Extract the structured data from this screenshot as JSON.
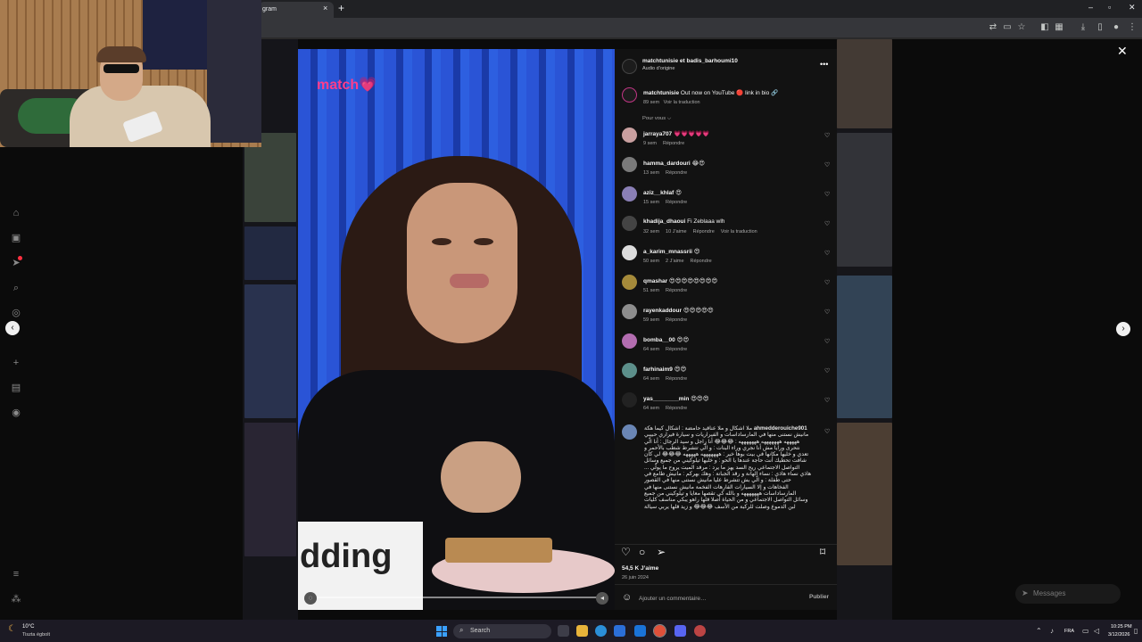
{
  "browser": {
    "tab_title": "gram",
    "new_tab_icon": "+",
    "close_tab_icon": "×"
  },
  "post": {
    "author": "matchtunisie et badis_barhoumi10",
    "audio": "Audio d’origine",
    "caption_user": "matchtunisie",
    "caption_text": "Out now on YouTube 🔴 link in bio 🔗",
    "caption_age": "89 sem",
    "caption_translate": "Voir la traduction",
    "sort_label": "Pour vous ⌵",
    "video_brand": "match💗",
    "card_text": "dding",
    "likes": "54,5 K J’aime",
    "date": "26 juin 2024",
    "comment_placeholder": "Ajouter un commentaire…",
    "post_button": "Publier"
  },
  "comments": [
    {
      "user": "jarraya707",
      "text": "💗💗💗💗💗",
      "age": "9 sem",
      "likes": "",
      "reply": "Répondre",
      "translate": "",
      "avatar": "#c9a0a0"
    },
    {
      "user": "hamma_dardouri",
      "text": "😂😍",
      "age": "13 sem",
      "likes": "",
      "reply": "Répondre",
      "translate": "",
      "avatar": "#7a7a7a"
    },
    {
      "user": "aziz__khlaf",
      "text": "😍",
      "age": "15 sem",
      "likes": "",
      "reply": "Répondre",
      "translate": "",
      "avatar": "#8a7fb5"
    },
    {
      "user": "khadija_dhaoui",
      "text": "Fi Zeblaaa wlh",
      "age": "32 sem",
      "likes": "10 J’aime",
      "reply": "Répondre",
      "translate": "Voir la traduction",
      "avatar": "#444"
    },
    {
      "user": "a_karim_mnassrii",
      "text": "😍",
      "age": "50 sem",
      "likes": "2 J’aime",
      "reply": "Répondre",
      "translate": "",
      "avatar": "#dcdcdc"
    },
    {
      "user": "qmashar",
      "text": "😍😍😍😍😍😍😍😍",
      "age": "51 sem",
      "likes": "",
      "reply": "Répondre",
      "translate": "",
      "avatar": "#a58a3a"
    },
    {
      "user": "rayenkaddour",
      "text": "😍😍😍😍😍",
      "age": "59 sem",
      "likes": "",
      "reply": "Répondre",
      "translate": "",
      "avatar": "#8d8d8d"
    },
    {
      "user": "bomba__00",
      "text": "😍😍",
      "age": "64 sem",
      "likes": "",
      "reply": "Répondre",
      "translate": "",
      "avatar": "#b36db0"
    },
    {
      "user": "farhinaim9",
      "text": "😍😍",
      "age": "64 sem",
      "likes": "",
      "reply": "Répondre",
      "translate": "",
      "avatar": "#5c8f8a"
    },
    {
      "user": "yas________min",
      "text": "😍😍😍",
      "age": "64 sem",
      "likes": "",
      "reply": "Répondre",
      "translate": "",
      "avatar": "#222"
    }
  ],
  "long_comment": {
    "user": "ahmedderouiche901",
    "text": "ملا اشكال و ملا عناقيد حامضة : أشكال كيما هكة مانيش نستنى منها في المارساداسات و الفيراريات و سيارة فيراري حبيبي هههههه هههههههه هههههههه : 😂😂😂 أنا راجل و سيد الرجال : أنا الّي نتحرى ورايا مش أنا نجري وراء البنات : و الّي تتشرط شطب بالأحمر و تعدي و خليها مكانها في بيت بوها خير : هههههههه هههههه 😂😂😂 لي كان شافت تحطيك أنت حاجة عندها يا الحو : و خليها تيلوكيني من جميع وسائل التواصل الاجتماعي ريح السد يهز ما يرد : مرقد الميت يروح ما يولّي ... هاذي نساء هاذي : نساء الهانة و رقد الجبانة : وهك بهركم : مانيش طامع في حتى طفلة : و الّي بش تتشرط عليا مانيش نستنى منها في القصور الفخاهات و إلا السيارات الفارهات الفخمة مانيش نستنى منها في المارساداسات هههههههه و بالله كي تقصها معايا و تيلوكيني من جميع وسائل التواصل الاجتماعي و من الحياة أصلا قلها راهو يبكي مناسف كليات لبن الدموع وصلت للركبة من الأسف 😂😂😂 و زيد قلها يربي سيالة"
  },
  "taskbar": {
    "temp": "10°C",
    "weather": "Tiszta égbolt",
    "search": "Search",
    "lang": "FRA",
    "time": "10:25 PM",
    "date": "3/12/2026"
  },
  "messages_label": "Messages",
  "colors": {
    "video_curtain": "#2a54d6",
    "brand_pink": "#ff3d8b",
    "panel_bg": "#121212"
  }
}
